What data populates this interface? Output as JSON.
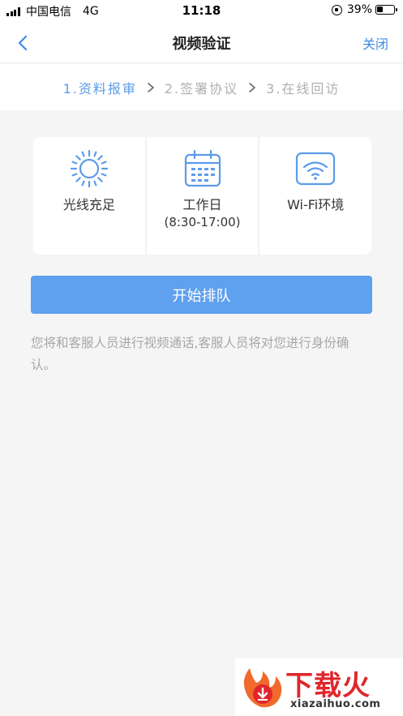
{
  "status_bar": {
    "carrier": "中国电信",
    "network": "4G",
    "time": "11:18",
    "battery": "39%",
    "battery_level": 0.39
  },
  "nav": {
    "title": "视频验证",
    "close_label": "关闭"
  },
  "steps": [
    {
      "label": "1.资料报审",
      "active": true
    },
    {
      "label": "2.签署协议",
      "active": false
    },
    {
      "label": "3.在线回访",
      "active": false
    }
  ],
  "requirements": [
    {
      "icon": "sun-icon",
      "title": "光线充足"
    },
    {
      "icon": "calendar-icon",
      "title": "工作日",
      "subtitle": "(8:30-17:00)"
    },
    {
      "icon": "wifi-icon",
      "title": "Wi-Fi环境"
    }
  ],
  "queue_button": "开始排队",
  "notice": "您将和客服人员进行视频通话,客服人员将对您进行身份确认。",
  "watermark": {
    "title": "下载火",
    "site": "xiazaihuo.com"
  },
  "colors": {
    "accent": "#3d8be6",
    "button": "#5fa0ef",
    "step_active": "#5b9bea",
    "watermark": "#e1262b"
  }
}
